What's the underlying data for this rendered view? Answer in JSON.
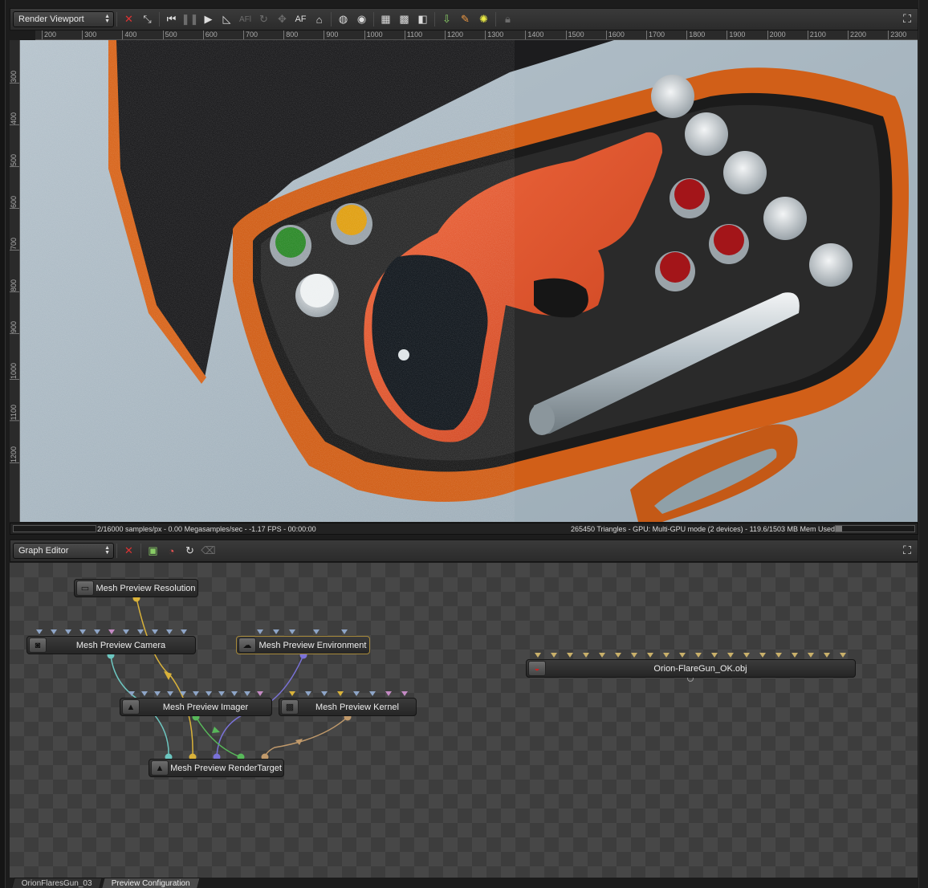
{
  "viewport_panel": {
    "selector_label": "Render Viewport",
    "toolbar_icons": [
      "close-scene-icon",
      "fit-view-icon",
      "rewind-icon",
      "pause-icon",
      "play-icon",
      "ruler-icon",
      "af-lock-icon",
      "rotate-icon",
      "focus-icon",
      "af-text-icon",
      "material-picker-icon",
      "sphere-icon",
      "globe-icon",
      "checker-bg-icon",
      "alpha-icon",
      "channels-icon",
      "export-icon",
      "picker-icon",
      "light-icon",
      "lock-icon"
    ],
    "af_text_dim": "AFl",
    "af_text": "AF",
    "ruler_h": [
      "200",
      "300",
      "400",
      "500",
      "600",
      "700",
      "800",
      "900",
      "1000",
      "1100",
      "1200",
      "1300",
      "1400",
      "1500",
      "1600",
      "1700",
      "1800",
      "1900",
      "2000",
      "2100",
      "2200",
      "2300"
    ],
    "ruler_v": [
      "300",
      "400",
      "500",
      "600",
      "700",
      "800",
      "900",
      "1000",
      "1100",
      "1200"
    ],
    "status_left": "2/16000 samples/px - 0.00 Megasamples/sec - -1.17 FPS - 00:00:00",
    "status_right": "265450 Triangles - GPU: Multi-GPU mode (2 devices) - 119.6/1503 MB Mem Used",
    "mem_used_fraction": 0.08
  },
  "graph_panel": {
    "selector_label": "Graph Editor",
    "toolbar_icons": [
      "close-graph-icon",
      "add-node-icon",
      "material-node-icon",
      "refresh-icon",
      "erase-icon"
    ],
    "nodes": {
      "resolution": "Mesh Preview Resolution",
      "camera": "Mesh Preview Camera",
      "environment": "Mesh Preview Environment",
      "imager": "Mesh Preview Imager",
      "kernel": "Mesh Preview Kernel",
      "render_target": "Mesh Preview RenderTarget",
      "mesh": "Orion-FlareGun_OK.obj"
    }
  },
  "tabs": [
    "OrionFlaresGun_03",
    "Preview Configuration"
  ]
}
